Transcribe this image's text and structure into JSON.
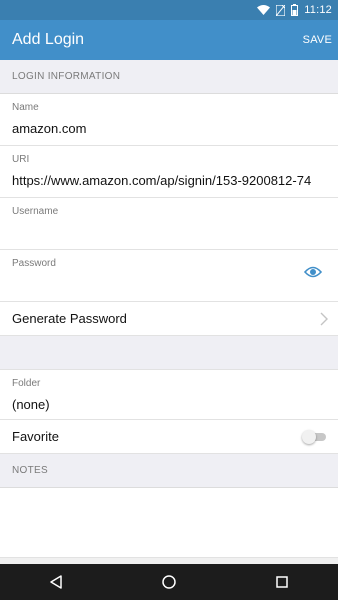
{
  "status_bar": {
    "time": "11:12"
  },
  "app_bar": {
    "title": "Add Login",
    "save_label": "SAVE",
    "color": "#418fc9"
  },
  "sections": {
    "login_information": "LOGIN INFORMATION",
    "notes": "NOTES"
  },
  "fields": {
    "name": {
      "label": "Name",
      "value": "amazon.com"
    },
    "uri": {
      "label": "URI",
      "value": "https://www.amazon.com/ap/signin/153-9200812-74"
    },
    "username": {
      "label": "Username",
      "value": ""
    },
    "password": {
      "label": "Password",
      "value": ""
    },
    "folder": {
      "label": "Folder",
      "value": "(none)"
    }
  },
  "generate_password": {
    "label": "Generate Password"
  },
  "favorite": {
    "label": "Favorite",
    "enabled": false
  },
  "icons": {
    "eye": "eye-icon",
    "chevron": "chevron-right-icon",
    "nav_back": "back-triangle-icon",
    "nav_home": "home-circle-icon",
    "nav_recents": "recents-square-icon"
  }
}
